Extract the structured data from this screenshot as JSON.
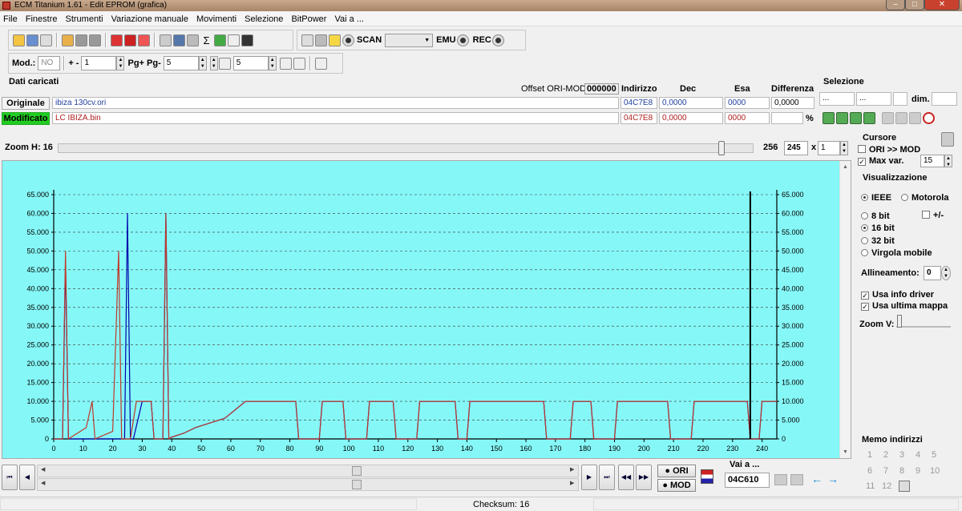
{
  "window": {
    "title": "ECM Titanium 1.61 - Edit EPROM (grafica)"
  },
  "menu": [
    "File",
    "Finestre",
    "Strumenti",
    "Variazione manuale",
    "Movimenti",
    "Selezione",
    "BitPower",
    "Vai a ..."
  ],
  "toolbar1": {
    "scan_label": "SCAN",
    "emu_label": "EMU",
    "rec_label": "REC"
  },
  "toolbar2": {
    "mod_label": "Mod.:",
    "mod_value": "NO",
    "plusminus_label": "+ -",
    "plusminus_value": "1",
    "pg_label": "Pg+ Pg-",
    "pg_value": "5",
    "step_value": "5"
  },
  "data_panel": {
    "title": "Dati caricati",
    "offset_label": "Offset ORI-MOD",
    "offset_value": "000000",
    "col_indirizzo": "Indirizzo",
    "col_dec": "Dec",
    "col_esa": "Esa",
    "col_diff": "Differenza",
    "originale_label": "Originale",
    "originale_file": "ibiza 130cv.ori",
    "ori_addr": "04C7E8",
    "ori_dec": "0,0000",
    "ori_esa": "0000",
    "ori_diff": "0,0000",
    "modificato_label": "Modificato",
    "modificato_file": "LC IBIZA.bin",
    "mod_addr": "04C7E8",
    "mod_dec": "0,0000",
    "mod_esa": "0000",
    "percent": "%"
  },
  "selezione": {
    "title": "Selezione",
    "f1": "...",
    "f2": "...",
    "dim_label": "dim."
  },
  "zoom": {
    "label": "Zoom H: 16",
    "max_value": "256",
    "value": "245",
    "x_label": "x",
    "mult": "1"
  },
  "cursore": {
    "title": "Cursore",
    "ori_mod": "ORI >> MOD",
    "max_var_label": "Max var.",
    "max_var_value": "15"
  },
  "visualizzazione": {
    "title": "Visualizzazione",
    "ieee": "IEEE",
    "motorola": "Motorola",
    "bit8": "8 bit",
    "plusminus": "+/-",
    "bit16": "16 bit",
    "bit32": "32 bit",
    "virgola": "Virgola mobile",
    "allineamento_label": "Allineamento:",
    "allineamento_value": "0",
    "usa_info": "Usa info driver",
    "usa_ultima": "Usa ultima mappa",
    "zoomv": "Zoom V:"
  },
  "memo": {
    "title": "Memo indirizzi",
    "numbers": [
      "1",
      "2",
      "3",
      "4",
      "5",
      "6",
      "7",
      "8",
      "9",
      "10",
      "11",
      "12"
    ]
  },
  "bottom": {
    "ori_btn": "ORI",
    "mod_btn": "MOD",
    "vai_label": "Vai a ...",
    "vai_value": "04C610"
  },
  "status": {
    "checksum": "Checksum: 16"
  },
  "colors": {
    "plot_bg": "#86f7f7",
    "ori_line": "#0000aa",
    "mod_line": "#c0392b",
    "modificato_bg": "#22cc22"
  },
  "chart_data": {
    "type": "line",
    "xlim": [
      0,
      245
    ],
    "ylim": [
      0,
      65000
    ],
    "xticks": [
      0,
      10,
      20,
      30,
      40,
      50,
      60,
      70,
      80,
      90,
      100,
      110,
      120,
      130,
      140,
      150,
      160,
      170,
      180,
      190,
      200,
      210,
      220,
      230,
      240
    ],
    "yticks": [
      0,
      5000,
      10000,
      15000,
      20000,
      25000,
      30000,
      35000,
      40000,
      45000,
      50000,
      55000,
      60000,
      65000
    ],
    "ytick_labels": [
      "0",
      "5.000",
      "10.000",
      "15.000",
      "20.000",
      "25.000",
      "30.000",
      "35.000",
      "40.000",
      "45.000",
      "50.000",
      "55.000",
      "60.000",
      "65.000"
    ],
    "cursor_x": 236,
    "series": [
      {
        "x": [
          0,
          3,
          4,
          5,
          13,
          14,
          22,
          23,
          24,
          25,
          26,
          27,
          30,
          31,
          33,
          34,
          37,
          38,
          39,
          40,
          44,
          48,
          52,
          58,
          65,
          73,
          74,
          82,
          83,
          90,
          91,
          98,
          99,
          106,
          107,
          115,
          116,
          123,
          124,
          132,
          133,
          136,
          137,
          140,
          141,
          150,
          151,
          160,
          161,
          166,
          167,
          175,
          176,
          182,
          183,
          190,
          191,
          200,
          201,
          208,
          209,
          216,
          217,
          228,
          229,
          235,
          236,
          239,
          240,
          245
        ],
        "y": [
          0,
          0,
          47000,
          0,
          0,
          0,
          0,
          0,
          0,
          60000,
          0,
          0,
          10000,
          10000,
          10000,
          0,
          0,
          60000,
          0,
          500,
          1500,
          3000,
          4000,
          5500,
          10000,
          10000,
          10000,
          10000,
          0,
          0,
          10000,
          10000,
          0,
          0,
          10000,
          10000,
          0,
          0,
          10000,
          10000,
          10000,
          10000,
          0,
          0,
          10000,
          10000,
          10000,
          10000,
          10000,
          10000,
          0,
          0,
          10000,
          10000,
          0,
          0,
          10000,
          10000,
          10000,
          10000,
          0,
          0,
          10000,
          10000,
          10000,
          10000,
          0,
          0,
          10000,
          10000
        ]
      },
      {
        "x": [
          0,
          3,
          4,
          5,
          11,
          13,
          14,
          20,
          22,
          23,
          24,
          26,
          28,
          30,
          33,
          34,
          37,
          38,
          39,
          40,
          44,
          48,
          52,
          58,
          65,
          73,
          74,
          82,
          83,
          90,
          91,
          98,
          99,
          106,
          107,
          115,
          116,
          123,
          124,
          132,
          133,
          136,
          137,
          140,
          141,
          150,
          151,
          160,
          161,
          166,
          167,
          175,
          176,
          182,
          183,
          190,
          191,
          200,
          201,
          208,
          209,
          216,
          217,
          228,
          229,
          235,
          236,
          239,
          240,
          245
        ],
        "y": [
          0,
          0,
          50000,
          0,
          3000,
          10000,
          0,
          2000,
          50000,
          0,
          0,
          0,
          10000,
          10000,
          10000,
          0,
          0,
          60000,
          0,
          500,
          1500,
          3000,
          4000,
          5500,
          10000,
          10000,
          10000,
          10000,
          0,
          0,
          10000,
          10000,
          0,
          0,
          10000,
          10000,
          0,
          0,
          10000,
          10000,
          10000,
          10000,
          0,
          0,
          10000,
          10000,
          10000,
          10000,
          10000,
          10000,
          0,
          0,
          10000,
          10000,
          0,
          0,
          10000,
          10000,
          10000,
          10000,
          0,
          0,
          10000,
          10000,
          10000,
          10000,
          0,
          0,
          10000,
          10000
        ]
      }
    ]
  }
}
